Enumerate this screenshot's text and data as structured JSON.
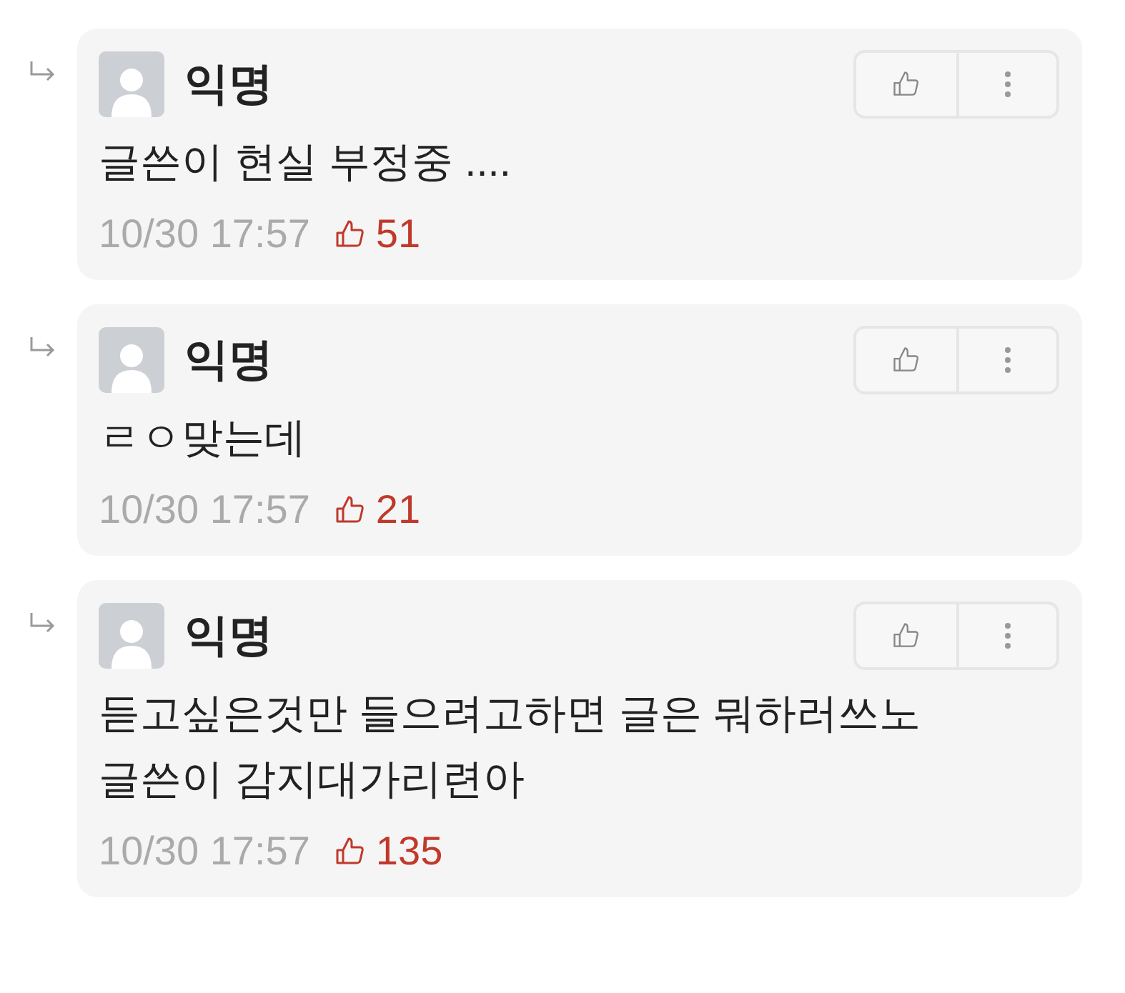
{
  "comments": [
    {
      "author": "익명",
      "lines": [
        "글쓴이 현실 부정중 ...."
      ],
      "time": "10/30 17:57",
      "likes": "51"
    },
    {
      "author": "익명",
      "lines": [
        "ㄹㅇ맞는데"
      ],
      "time": "10/30 17:57",
      "likes": "21"
    },
    {
      "author": "익명",
      "lines": [
        "듣고싶은것만 들으려고하면 글은 뭐하러쓰노",
        "글쓴이 감지대가리련아"
      ],
      "time": "10/30 17:57",
      "likes": "135"
    }
  ]
}
